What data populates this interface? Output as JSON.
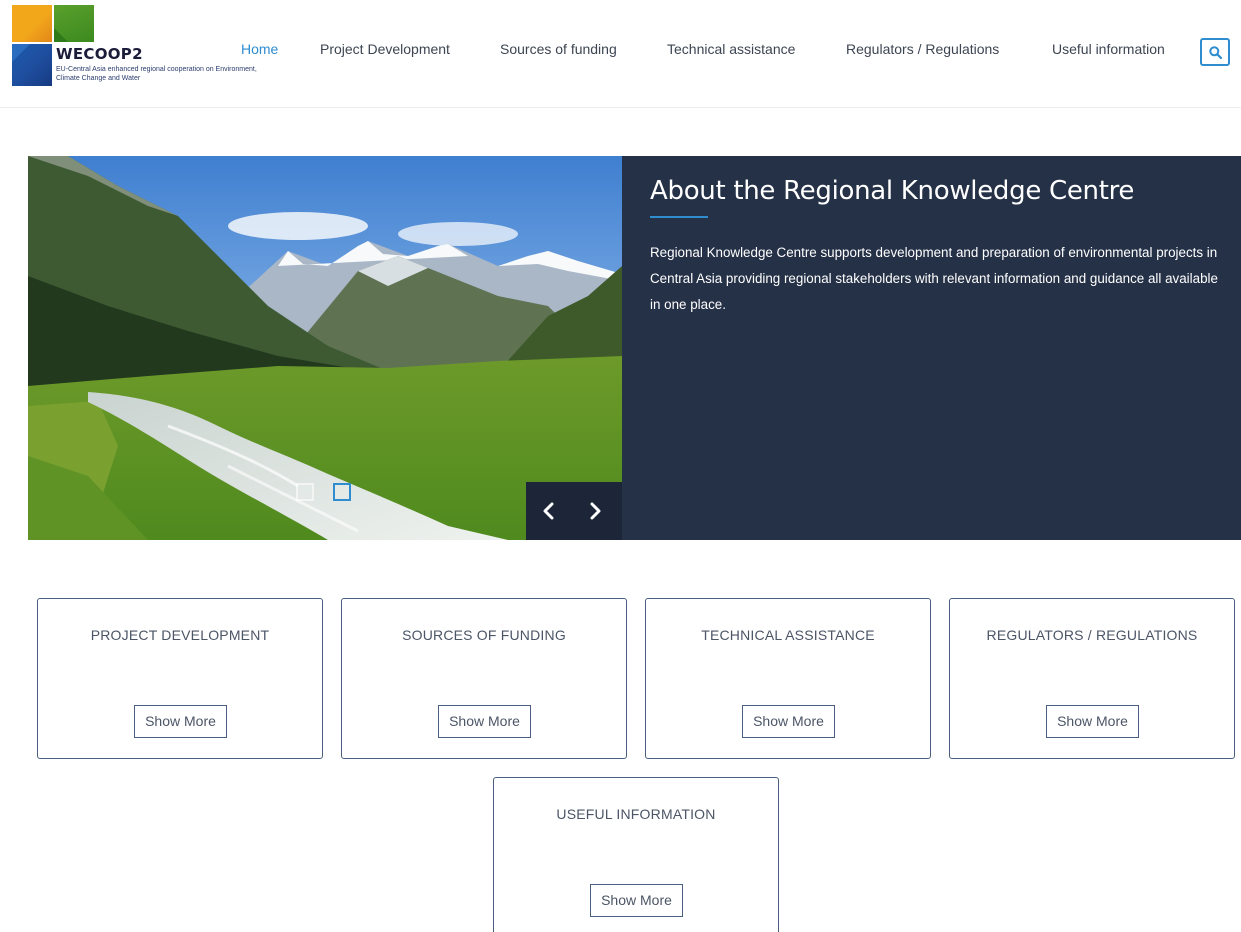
{
  "brand": {
    "title": "WECOOP2",
    "subtitle": "EU-Central Asia enhanced regional cooperation on Environment, Climate Change and Water",
    "colors": {
      "orange": "#f2a71b",
      "green": "#4a962a",
      "blue": "#1c5aa8"
    }
  },
  "nav": {
    "items": [
      {
        "label": "Home",
        "active": true
      },
      {
        "label": "Project Development",
        "active": false
      },
      {
        "label": "Sources of funding",
        "active": false
      },
      {
        "label": "Technical assistance",
        "active": false
      },
      {
        "label": "Regulators / Regulations",
        "active": false
      },
      {
        "label": "Useful information",
        "active": false
      }
    ],
    "search_icon": "search-icon",
    "accent_color": "#2e8ccf"
  },
  "hero": {
    "image": "mountain-valley-river-photo",
    "title": "About the Regional Knowledge Centre",
    "text": "Regional Knowledge Centre supports development and preparation of environmental projects in Central Asia providing regional stakeholders with relevant information and guidance all available in one place.",
    "panel_color": "#253147",
    "slide_count": 2,
    "active_slide": 2,
    "prev_icon": "chevron-left-icon",
    "next_icon": "chevron-right-icon"
  },
  "cards": [
    {
      "title": "PROJECT DEVELOPMENT",
      "button": "Show More"
    },
    {
      "title": "SOURCES OF FUNDING",
      "button": "Show More"
    },
    {
      "title": "TECHNICAL ASSISTANCE",
      "button": "Show More"
    },
    {
      "title": "REGULATORS / REGULATIONS",
      "button": "Show More"
    },
    {
      "title": "USEFUL INFORMATION",
      "button": "Show More"
    }
  ]
}
